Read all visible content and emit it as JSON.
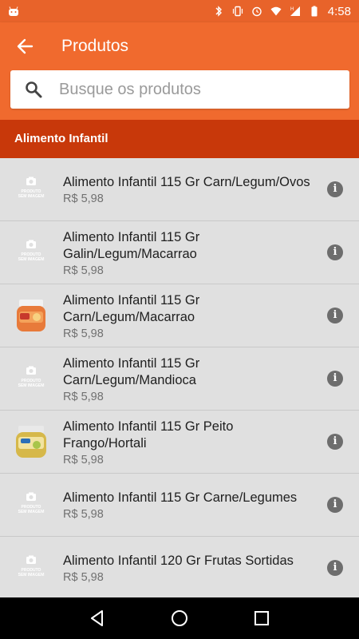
{
  "status_bar": {
    "time": "4:58",
    "icons": [
      "android-icon",
      "bluetooth-icon",
      "vibrate-icon",
      "alarm-icon",
      "wifi-icon",
      "signal-h-icon",
      "battery-icon"
    ]
  },
  "app_bar": {
    "title": "Produtos",
    "search_placeholder": "Busque os produtos"
  },
  "section": {
    "title": "Alimento Infantil"
  },
  "products": [
    {
      "name": "Alimento Infantil 115 Gr Carn/Legum/Ovos",
      "price": "R$ 5,98",
      "image": "no-image"
    },
    {
      "name": "Alimento Infantil 115 Gr Galin/Legum/Macarrao",
      "price": "R$ 5,98",
      "image": "no-image"
    },
    {
      "name": "Alimento Infantil 115 Gr Carn/Legum/Macarrao",
      "price": "R$ 5,98",
      "image": "jar-orange"
    },
    {
      "name": "Alimento Infantil 115 Gr Carn/Legum/Mandioca",
      "price": "R$ 5,98",
      "image": "no-image"
    },
    {
      "name": "Alimento Infantil 115 Gr Peito Frango/Hortali",
      "price": "R$ 5,98",
      "image": "jar-yellow"
    },
    {
      "name": "Alimento Infantil 115 Gr Carne/Legumes",
      "price": "R$ 5,98",
      "image": "no-image"
    },
    {
      "name": "Alimento Infantil 120 Gr Frutas Sortidas",
      "price": "R$ 5,98",
      "image": "no-image"
    }
  ],
  "no_image_text": [
    "PRODUTO",
    "SEM IMAGEM"
  ],
  "colors": {
    "status_bar": "#e8632a",
    "app_bar": "#f06a2e",
    "section_header": "#c8380a",
    "list_bg": "#e0e0e0"
  },
  "nav_bar": {
    "buttons": [
      "back-triangle-icon",
      "home-circle-icon",
      "recents-square-icon"
    ]
  }
}
